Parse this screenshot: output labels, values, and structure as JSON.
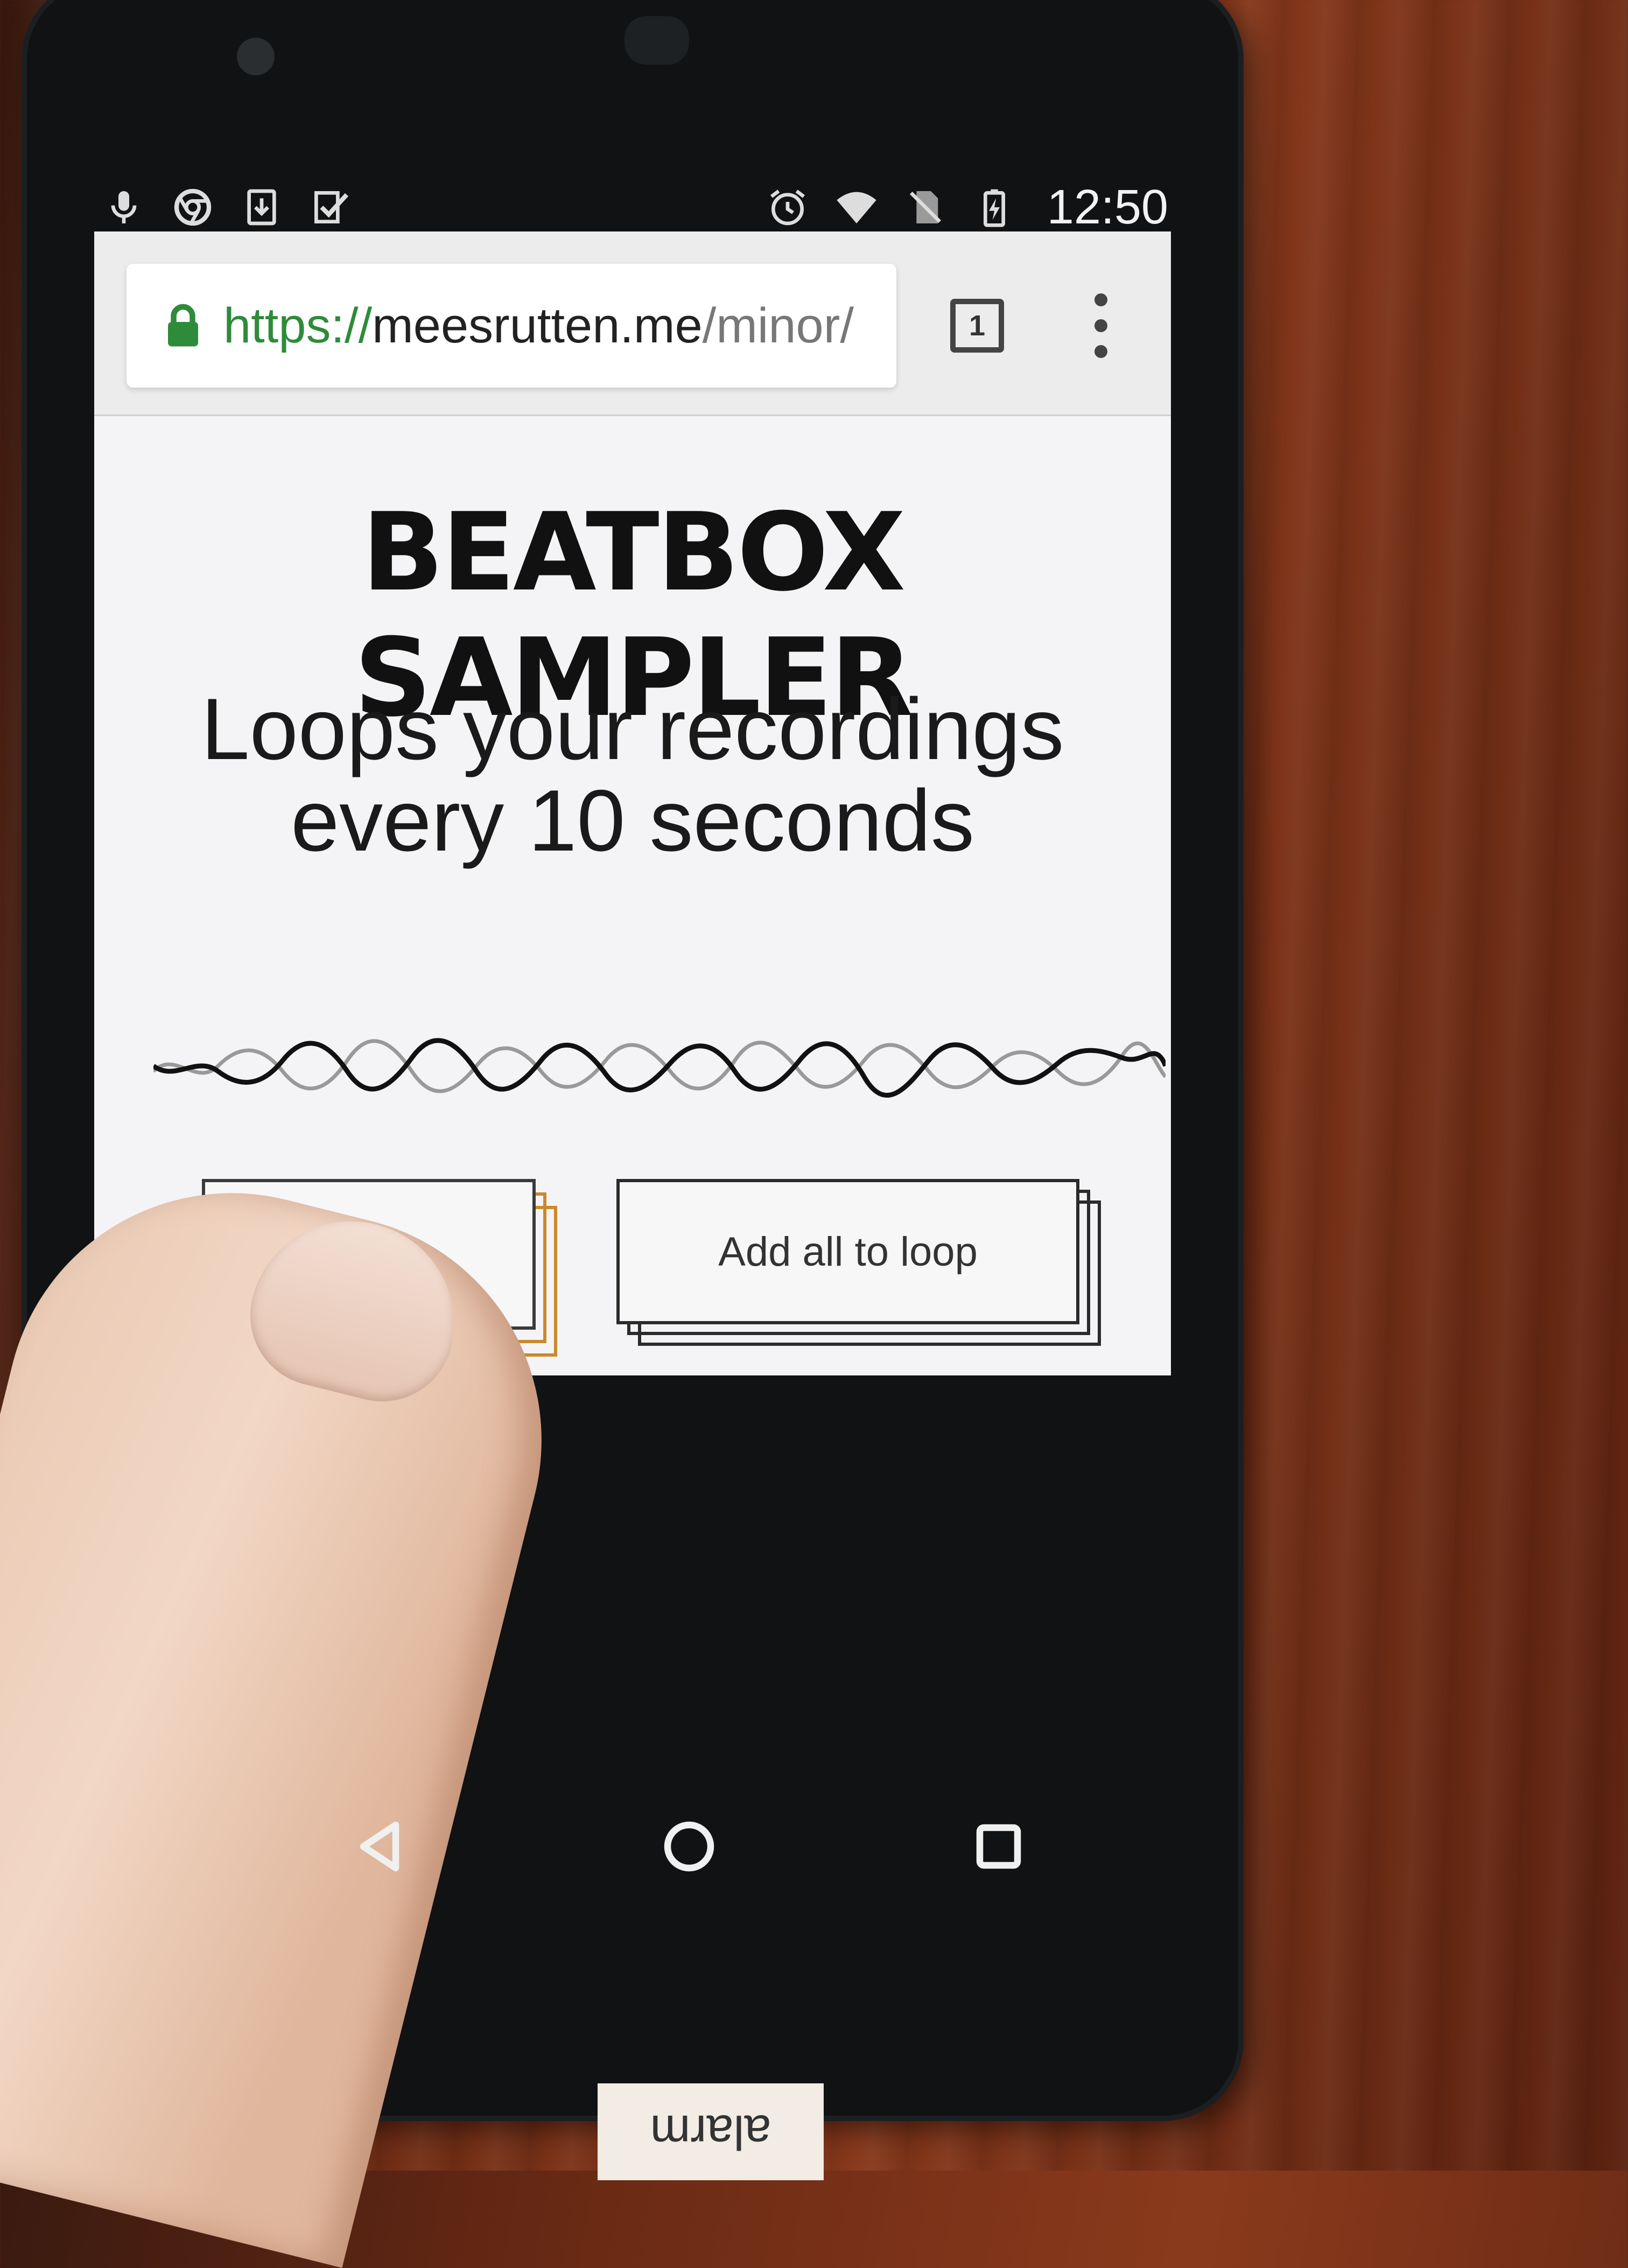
{
  "status_bar": {
    "time": "12:50",
    "left_icons": [
      "mic-icon",
      "chrome-icon",
      "download-icon",
      "check-icon"
    ],
    "right_icons": [
      "alarm-icon",
      "wifi-icon",
      "no-sim-icon",
      "battery-charging-icon"
    ]
  },
  "browser": {
    "url_scheme": "https://",
    "url_host": "meesrutten.me",
    "url_path": "/minor/",
    "tab_count": "1",
    "secure_icon": "lock-icon"
  },
  "page": {
    "title": "BEATBOX SAMPLER",
    "subtitle_line1": "Loops your recordings",
    "subtitle_line2": "every 10 seconds",
    "record_button_label": "",
    "add_all_button_label": "Add all to loop"
  },
  "nav_bar": {
    "icons": [
      "back-icon",
      "home-icon",
      "recents-icon"
    ]
  },
  "sticker": {
    "text": "alarm"
  },
  "colors": {
    "url_secure": "#2e8b3a",
    "page_background": "#f4f4f6",
    "button_border": "#2b2b2b"
  }
}
